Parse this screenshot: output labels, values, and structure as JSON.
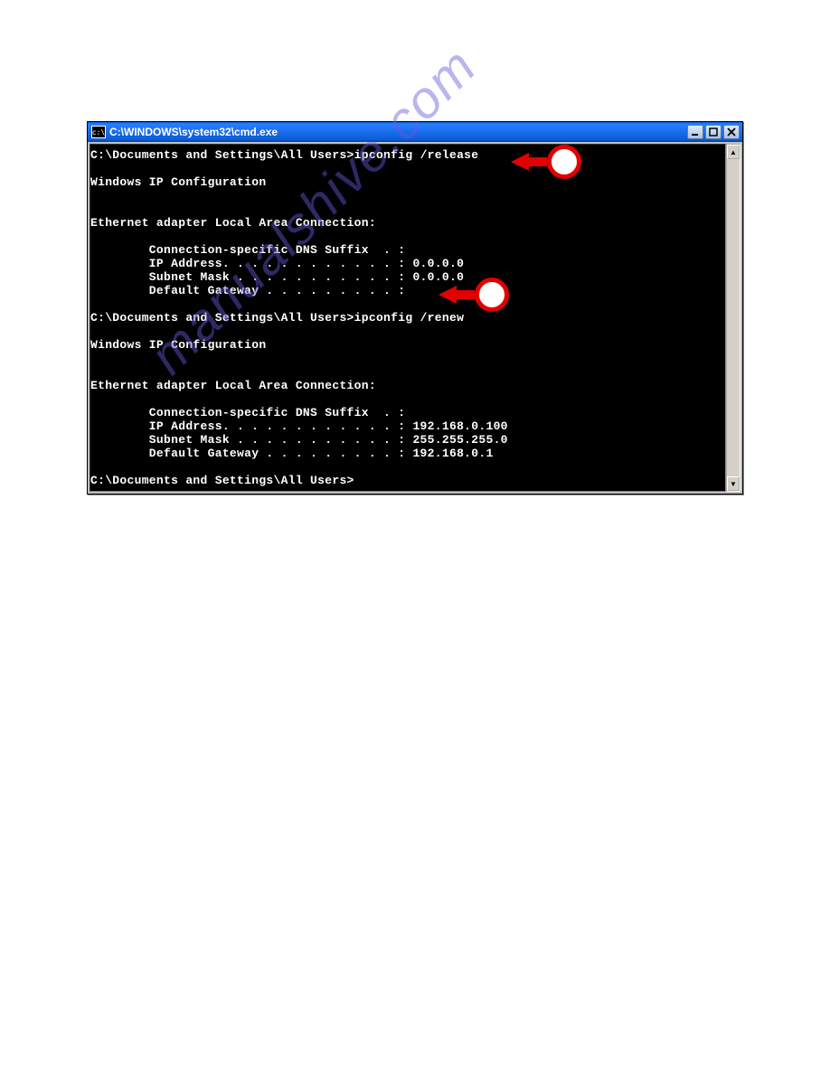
{
  "window": {
    "title": "C:\\WINDOWS\\system32\\cmd.exe",
    "icon_text": "c:\\"
  },
  "terminal": {
    "line1_prompt": "C:\\Documents and Settings\\All Users>",
    "line1_cmd": "ipconfig /release",
    "blank": "",
    "header1": "Windows IP Configuration",
    "adapter1": "Ethernet adapter Local Area Connection:",
    "dns1": "        Connection-specific DNS Suffix  . :",
    "ip1": "        IP Address. . . . . . . . . . . . : 0.0.0.0",
    "mask1": "        Subnet Mask . . . . . . . . . . . : 0.0.0.0",
    "gw1": "        Default Gateway . . . . . . . . . :",
    "line2_prompt": "C:\\Documents and Settings\\All Users>",
    "line2_cmd": "ipconfig /renew",
    "header2": "Windows IP Configuration",
    "adapter2": "Ethernet adapter Local Area Connection:",
    "dns2": "        Connection-specific DNS Suffix  . :",
    "ip2": "        IP Address. . . . . . . . . . . . : 192.168.0.100",
    "mask2": "        Subnet Mask . . . . . . . . . . . : 255.255.255.0",
    "gw2": "        Default Gateway . . . . . . . . . : 192.168.0.1",
    "line3_prompt": "C:\\Documents and Settings\\All Users>"
  },
  "watermark": "manualshive.com"
}
